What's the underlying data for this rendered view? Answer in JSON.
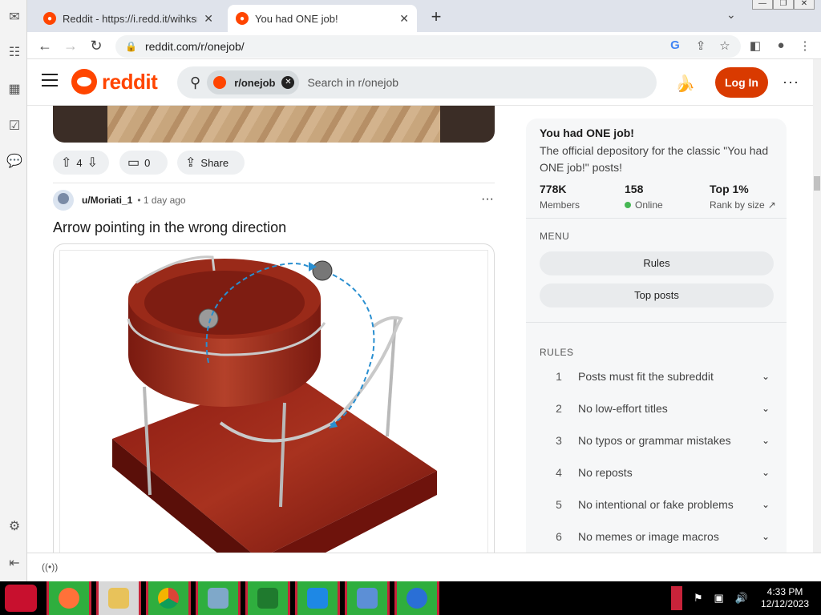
{
  "tabs": [
    {
      "title": "Reddit - https://i.redd.it/wihksn0",
      "active": false
    },
    {
      "title": "You had ONE job!",
      "active": true
    }
  ],
  "address": "reddit.com/r/onejob/",
  "header": {
    "logo_text": "reddit",
    "chip_label": "r/onejob",
    "search_placeholder": "Search in r/onejob",
    "login_label": "Log In",
    "more": "···"
  },
  "post_actions": {
    "votes": "4",
    "comments": "0",
    "share_label": "Share"
  },
  "post": {
    "user": "u/Moriati_1",
    "time": "• 1 day ago",
    "title": "Arrow pointing in the wrong direction",
    "more": "···"
  },
  "sidebar": {
    "title": "You had ONE job!",
    "description": "The official depository for the classic \"You had ONE job!\" posts!",
    "stats": [
      {
        "value": "778K",
        "label": "Members"
      },
      {
        "value": "158",
        "label": "Online"
      },
      {
        "value": "Top 1%",
        "label": "Rank by size"
      }
    ],
    "menu_heading": "MENU",
    "menu": [
      "Rules",
      "Top posts"
    ],
    "rules_heading": "RULES",
    "rules": [
      {
        "num": "1",
        "text": "Posts must fit the subreddit"
      },
      {
        "num": "2",
        "text": "No low-effort titles"
      },
      {
        "num": "3",
        "text": "No typos or grammar mistakes"
      },
      {
        "num": "4",
        "text": "No reposts"
      },
      {
        "num": "5",
        "text": "No intentional or fake problems"
      },
      {
        "num": "6",
        "text": "No memes or image macros"
      }
    ]
  },
  "taskbar": {
    "time": "4:33 PM",
    "date": "12/12/2023"
  },
  "colors": {
    "reddit_orange": "#ff4500",
    "login_bg": "#d93a00",
    "taskbar_btn": "#2fae3e",
    "taskbar_border": "#c8233a"
  }
}
